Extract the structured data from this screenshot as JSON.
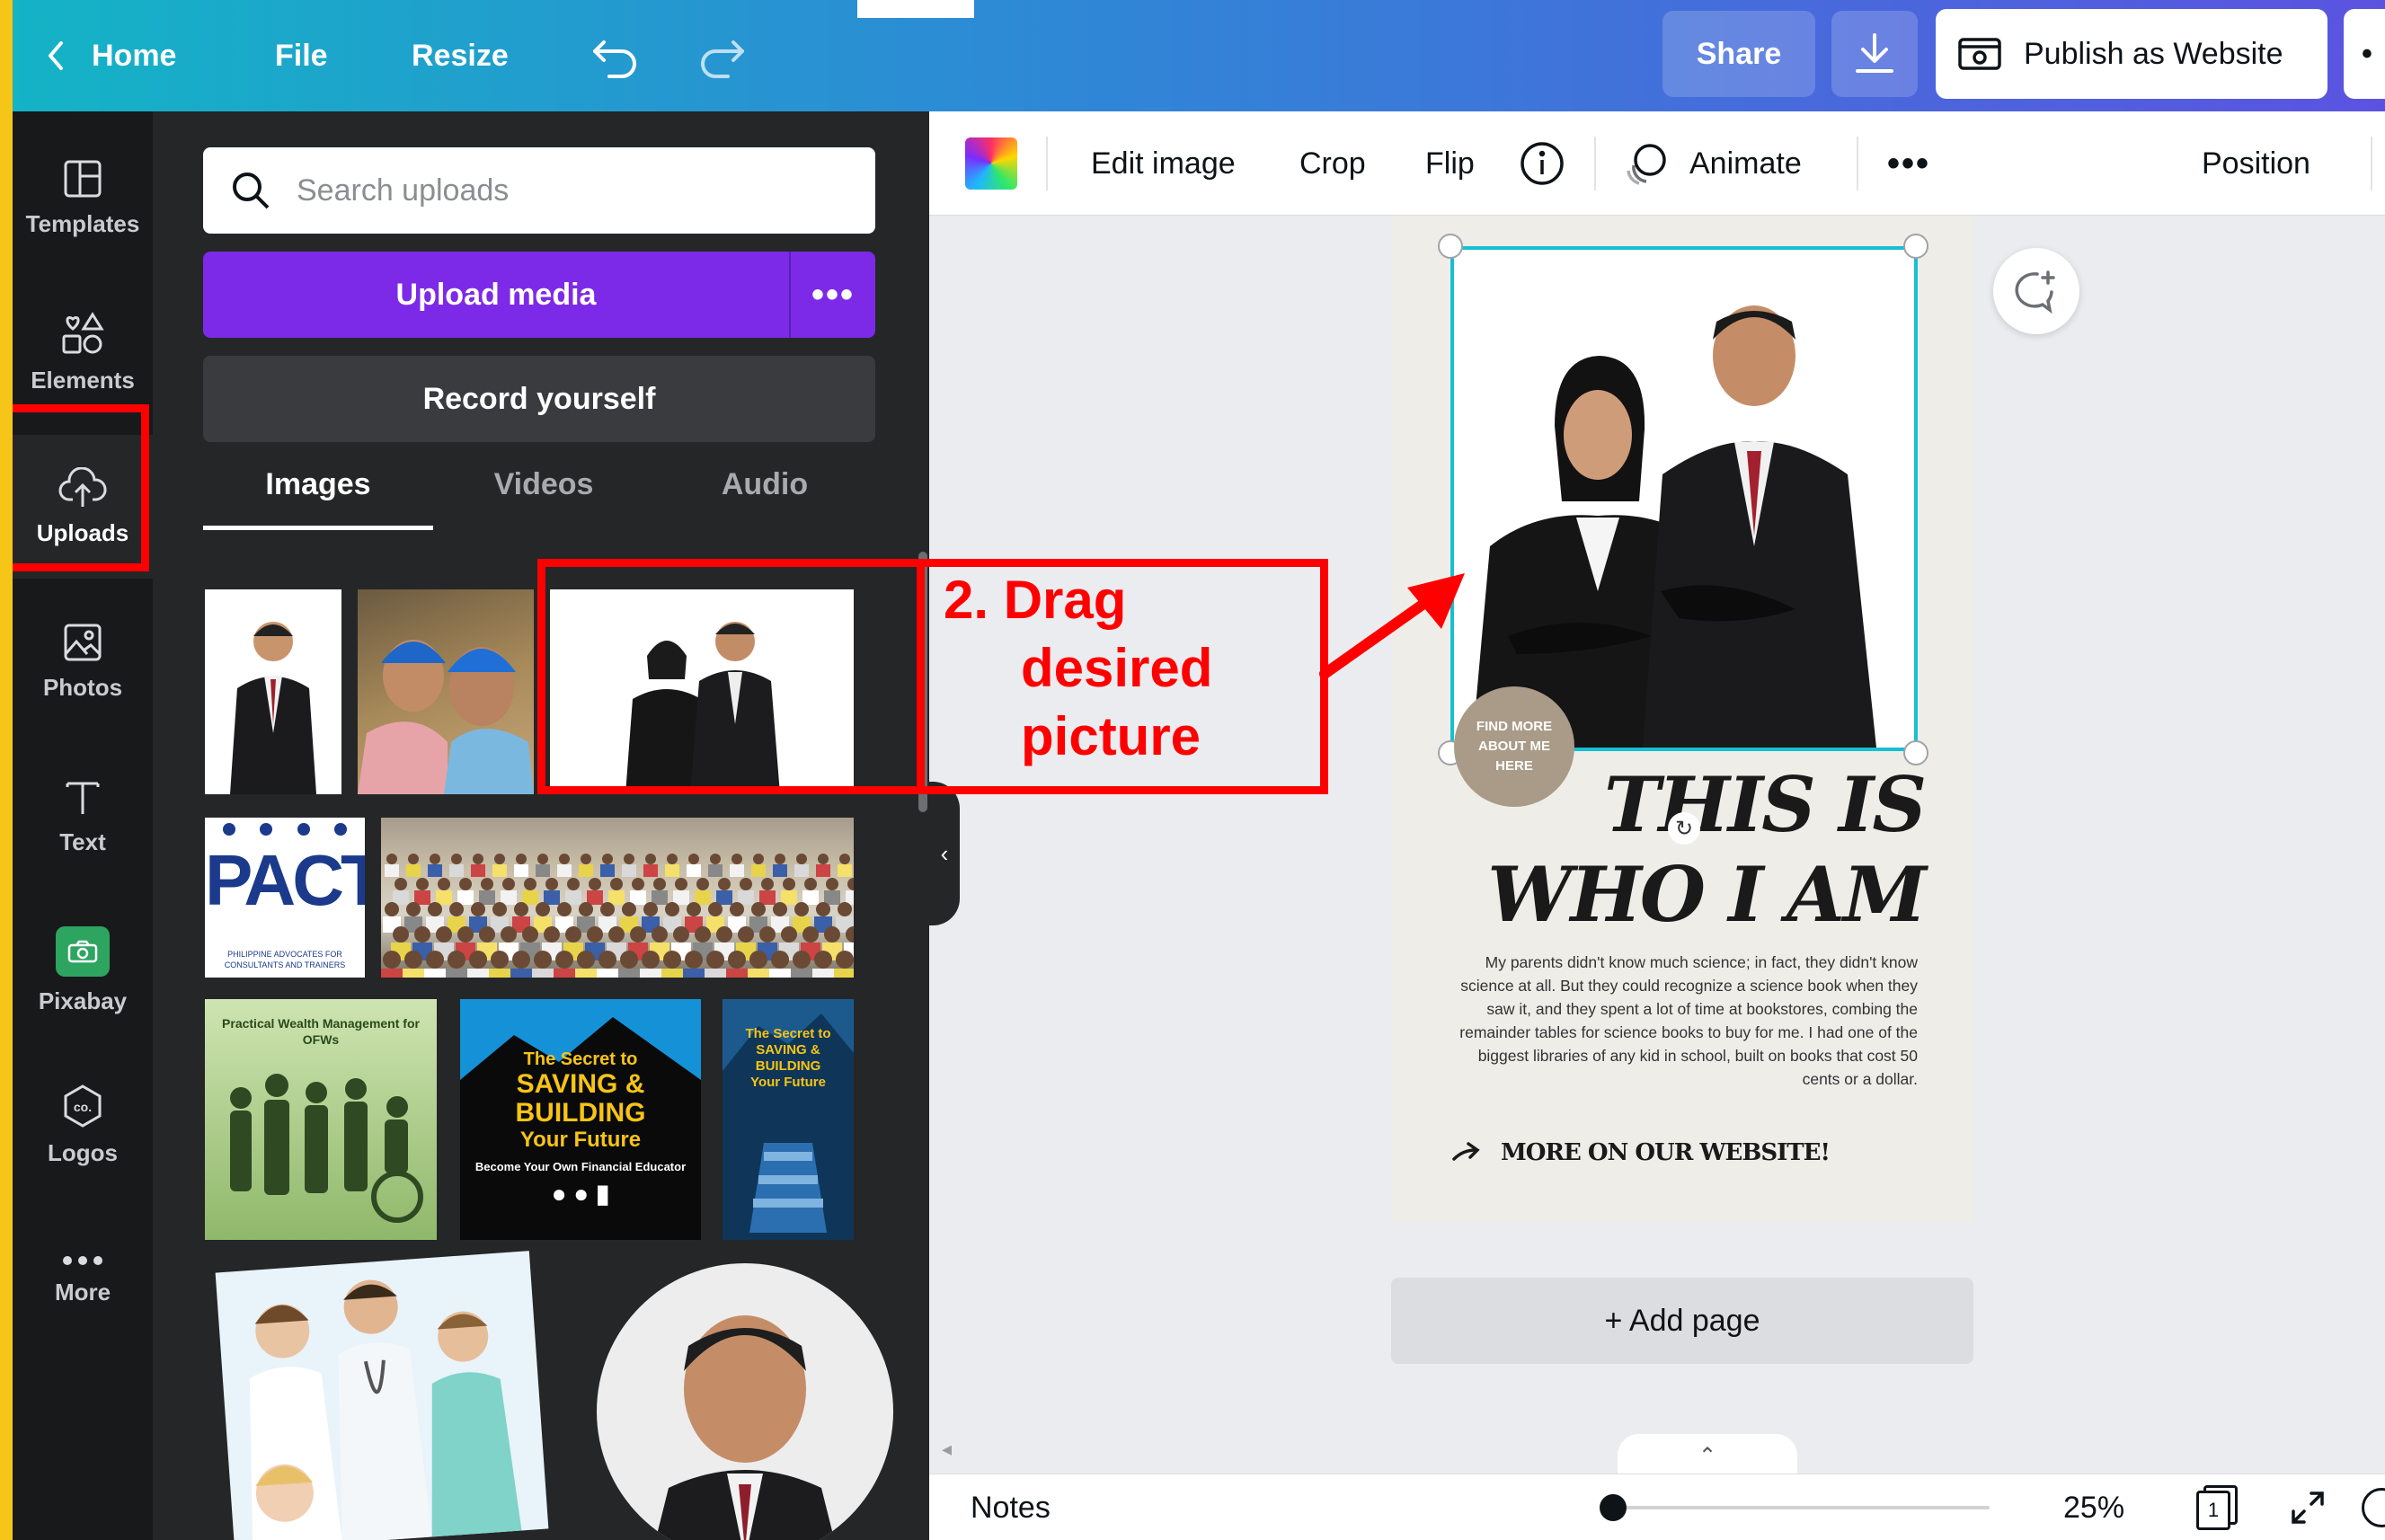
{
  "topbar": {
    "home": "Home",
    "file": "File",
    "resize": "Resize",
    "share": "Share",
    "publish": "Publish as Website",
    "more": "•"
  },
  "leftnav": {
    "items": [
      {
        "label": "Templates",
        "icon": "templates-icon"
      },
      {
        "label": "Elements",
        "icon": "elements-icon"
      },
      {
        "label": "Uploads",
        "icon": "upload-cloud-icon"
      },
      {
        "label": "Photos",
        "icon": "photos-icon"
      },
      {
        "label": "Text",
        "icon": "text-icon"
      },
      {
        "label": "Pixabay",
        "icon": "pixabay-icon"
      },
      {
        "label": "Logos",
        "icon": "logos-icon"
      },
      {
        "label": "More",
        "icon": "more-icon"
      }
    ]
  },
  "uploads": {
    "search_placeholder": "Search uploads",
    "upload_media": "Upload media",
    "upload_more": "•••",
    "record": "Record yourself",
    "tabs": [
      "Images",
      "Videos",
      "Audio"
    ],
    "thumbs": {
      "pact_logo": "PACT",
      "pact_sub": "PHILIPPINE ADVOCATES FOR CONSULTANTS AND TRAINERS",
      "book1_title": "Practical Wealth Management for OFWs",
      "book2_line1": "The Secret to",
      "book2_line2": "SAVING &",
      "book2_line3": "BUILDING",
      "book2_line4": "Your Future",
      "book2_line5": "Become Your Own Financial Educator",
      "book3_line1": "The Secret to",
      "book3_line2": "SAVING & BUILDING",
      "book3_line3": "Your Future"
    }
  },
  "toolbar": {
    "edit_image": "Edit image",
    "crop": "Crop",
    "flip": "Flip",
    "animate": "Animate",
    "more": "•••",
    "position": "Position"
  },
  "canvas": {
    "badge": "FIND MORE ABOUT ME HERE",
    "title_line1": "THIS IS",
    "title_line2": "WHO I AM",
    "body": "My parents didn't know much science; in fact, they didn't know science at all. But they could recognize a science book when they saw it, and they spent a lot of time at bookstores, combing the remainder tables for science books to buy for me. I had one of the biggest libraries of any kid in school, built on books that cost 50 cents or a dollar.",
    "more_link": "MORE ON OUR WEBSITE!",
    "add_page": "+ Add page"
  },
  "bottombar": {
    "notes": "Notes",
    "zoom": "25%",
    "page_num": "1"
  },
  "annotation": {
    "line1": "2.  Drag",
    "line2": "desired",
    "line3": "picture",
    "color": "#ff0000"
  },
  "colors": {
    "accent_purple": "#7d2ae8",
    "selection_teal": "#16c0d0",
    "panel_dark": "#252627",
    "nav_dark": "#18191b"
  }
}
